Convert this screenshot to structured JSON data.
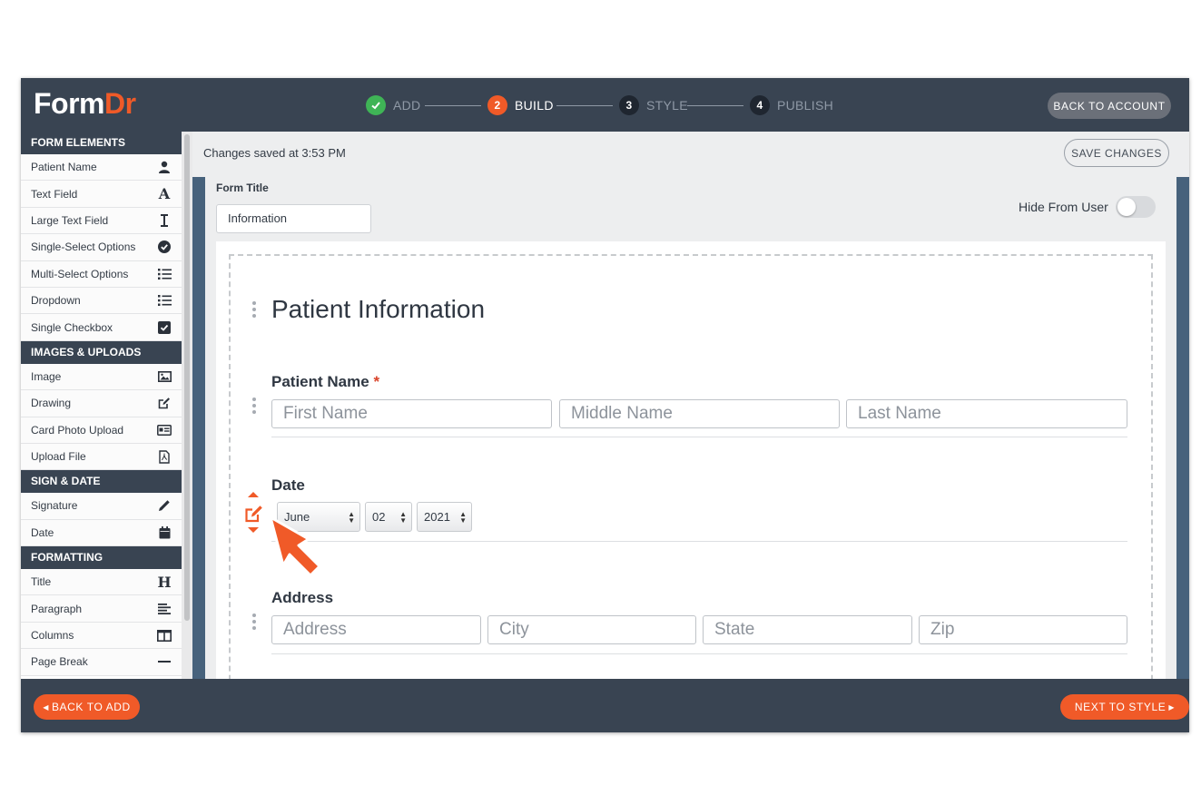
{
  "app": {
    "logo_part1": "Form",
    "logo_part2": "Dr",
    "accent_color": "#f05a28",
    "header_color": "#394452"
  },
  "steps": [
    {
      "label": "ADD",
      "number": "",
      "state": "done"
    },
    {
      "label": "BUILD",
      "number": "2",
      "state": "active"
    },
    {
      "label": "STYLE",
      "number": "3",
      "state": "todo"
    },
    {
      "label": "PUBLISH",
      "number": "4",
      "state": "todo"
    }
  ],
  "header": {
    "back_to_account": "BACK TO ACCOUNT"
  },
  "sidebar": {
    "sections": [
      {
        "title": "FORM ELEMENTS",
        "items": [
          {
            "label": "Patient Name",
            "icon": "user-icon"
          },
          {
            "label": "Text Field",
            "icon": "text-a-icon"
          },
          {
            "label": "Large Text Field",
            "icon": "text-cursor-icon"
          },
          {
            "label": "Single-Select Options",
            "icon": "check-circle-icon"
          },
          {
            "label": "Multi-Select Options",
            "icon": "list-icon"
          },
          {
            "label": "Dropdown",
            "icon": "list-icon"
          },
          {
            "label": "Single Checkbox",
            "icon": "checkbox-icon"
          }
        ]
      },
      {
        "title": "IMAGES & UPLOADS",
        "items": [
          {
            "label": "Image",
            "icon": "image-icon"
          },
          {
            "label": "Drawing",
            "icon": "edit-icon"
          },
          {
            "label": "Card Photo Upload",
            "icon": "id-card-icon"
          },
          {
            "label": "Upload File",
            "icon": "pdf-file-icon"
          }
        ]
      },
      {
        "title": "SIGN & DATE",
        "items": [
          {
            "label": "Signature",
            "icon": "pencil-icon"
          },
          {
            "label": "Date",
            "icon": "calendar-icon"
          }
        ]
      },
      {
        "title": "FORMATTING",
        "items": [
          {
            "label": "Title",
            "icon": "heading-icon"
          },
          {
            "label": "Paragraph",
            "icon": "align-left-icon"
          },
          {
            "label": "Columns",
            "icon": "columns-icon"
          },
          {
            "label": "Page Break",
            "icon": "page-break-icon"
          }
        ]
      }
    ]
  },
  "main": {
    "saved_status": "Changes saved at 3:53 PM",
    "save_button": "SAVE CHANGES",
    "form_title_label": "Form Title",
    "form_title_value": "Information",
    "hide_from_user_label": "Hide From User",
    "hide_from_user_on": false
  },
  "form": {
    "heading": "Patient Information",
    "patient_name": {
      "label": "Patient Name",
      "required_mark": "*",
      "first_placeholder": "First Name",
      "middle_placeholder": "Middle Name",
      "last_placeholder": "Last Name"
    },
    "date": {
      "label": "Date",
      "month": "June",
      "day": "02",
      "year": "2021"
    },
    "address": {
      "label": "Address",
      "address_placeholder": "Address",
      "city_placeholder": "City",
      "state_placeholder": "State",
      "zip_placeholder": "Zip"
    }
  },
  "footer": {
    "back_to_add": "BACK TO ADD",
    "next_to_style": "NEXT TO STYLE"
  }
}
